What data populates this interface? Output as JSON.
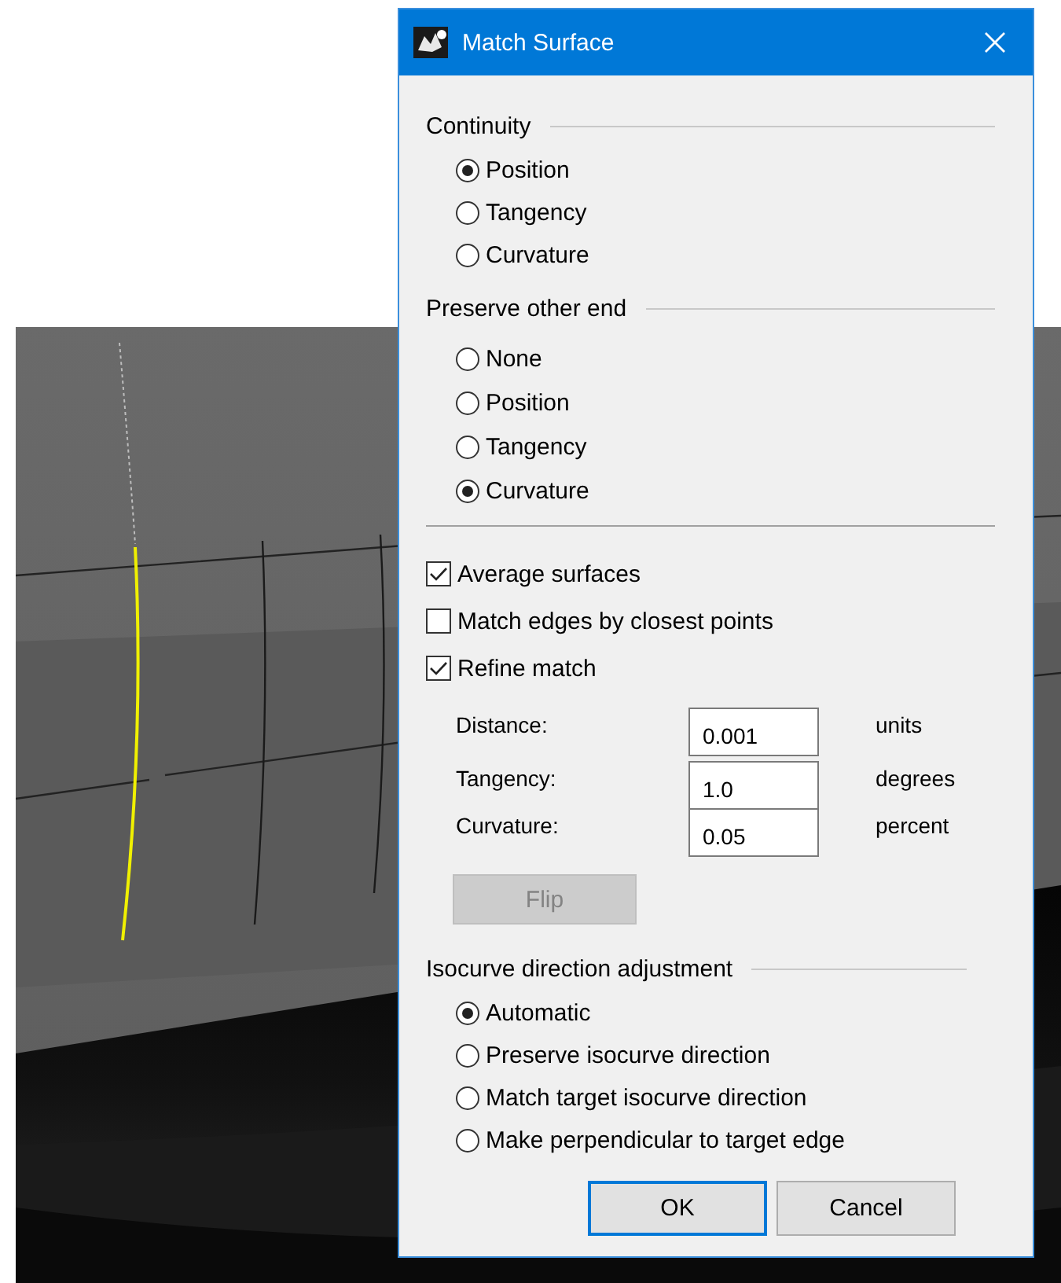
{
  "dialog": {
    "title": "Match Surface",
    "option_groups": [
      {
        "heading": "Continuity",
        "options": [
          {
            "label": "Position",
            "selected": true
          },
          {
            "label": "Tangency",
            "selected": false
          },
          {
            "label": "Curvature",
            "selected": false
          }
        ]
      },
      {
        "heading": "Preserve other end",
        "options": [
          {
            "label": "None",
            "selected": false
          },
          {
            "label": "Position",
            "selected": false
          },
          {
            "label": "Tangency",
            "selected": false
          },
          {
            "label": "Curvature",
            "selected": true
          }
        ]
      }
    ],
    "checkboxes": [
      {
        "label": "Average surfaces",
        "checked": true
      },
      {
        "label": "Match edges by closest points",
        "checked": false
      },
      {
        "label": "Refine match",
        "checked": true
      }
    ],
    "fields": [
      {
        "label": "Distance:",
        "value": "0.001",
        "unit": "units"
      },
      {
        "label": "Tangency:",
        "value": "1.0",
        "unit": "degrees"
      },
      {
        "label": "Curvature:",
        "value": "0.05",
        "unit": "percent"
      }
    ],
    "flip_button": {
      "label": "Flip",
      "disabled": true
    },
    "isocurve_group": {
      "heading": "Isocurve direction adjustment",
      "options": [
        {
          "label": "Automatic",
          "selected": true
        },
        {
          "label": "Preserve isocurve direction",
          "selected": false
        },
        {
          "label": "Match target isocurve direction",
          "selected": false
        },
        {
          "label": "Make perpendicular to target edge",
          "selected": false
        }
      ]
    },
    "buttons": [
      {
        "label": "OK",
        "default": true
      },
      {
        "label": "Cancel",
        "default": false
      }
    ]
  }
}
